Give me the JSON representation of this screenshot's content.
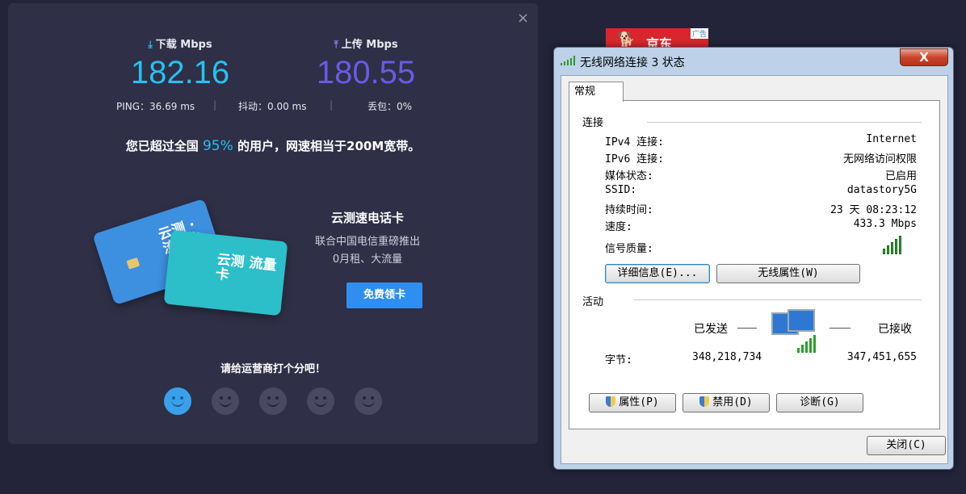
{
  "speedtest": {
    "download": {
      "icon": "download-arrow-icon",
      "label": "下载 Mbps",
      "value": "182.16"
    },
    "upload": {
      "icon": "upload-arrow-icon",
      "label": "上传 Mbps",
      "value": "180.55"
    },
    "ping": "PING：36.69 ms",
    "jitter": "抖动：0.00 ms",
    "loss": "丢包：0%",
    "separator": "|",
    "exceed_prefix": "您已超过全国",
    "exceed_pct": "95%",
    "exceed_suffix": "的用户，网速相当于200M宽带。",
    "promo": {
      "title": "云测速电话卡",
      "line1": "联合中国电信重磅推出",
      "line2": "0月租、大流量",
      "button": "免费领卡",
      "card1_text": "云测 · 流量卡",
      "card2_text": "云测 流量卡"
    },
    "rate_title": "请给运营商打个分吧！",
    "faces": [
      "smile-face-icon",
      "smile-face-icon",
      "smile-face-icon",
      "smile-face-icon",
      "smile-face-icon"
    ],
    "close_icon": "×",
    "colors": {
      "download": "#25c2f0",
      "upload": "#6a5ae6",
      "button": "#2e8ff0"
    }
  },
  "ad": {
    "text": "京东",
    "tag": "广告"
  },
  "dialog": {
    "title": "无线网络连接 3 状态",
    "close_glyph": "X",
    "tab": "常规",
    "connection_group": "连接",
    "rows": [
      {
        "k": "IPv4 连接:",
        "v": "Internet"
      },
      {
        "k": "IPv6 连接:",
        "v": "无网络访问权限"
      },
      {
        "k": "媒体状态:",
        "v": "已启用"
      },
      {
        "k": "SSID:",
        "v": "datastory5G"
      },
      {
        "k": "持续时间:",
        "v": "23 天 08:23:12"
      },
      {
        "k": "速度:",
        "v": "433.3 Mbps"
      }
    ],
    "signal_label": "信号质量:",
    "signal_level": 5,
    "details_button": "详细信息(E)...",
    "wireless_props_button": "无线属性(W)",
    "activity_group": "活动",
    "sent_label": "已发送",
    "received_label": "已接收",
    "bytes_label": "字节:",
    "bytes_sent": "348,218,734",
    "bytes_received": "347,451,655",
    "properties_button": "属性(P)",
    "disable_button": "禁用(D)",
    "diagnose_button": "诊断(G)",
    "close_button": "关闭(C)"
  }
}
